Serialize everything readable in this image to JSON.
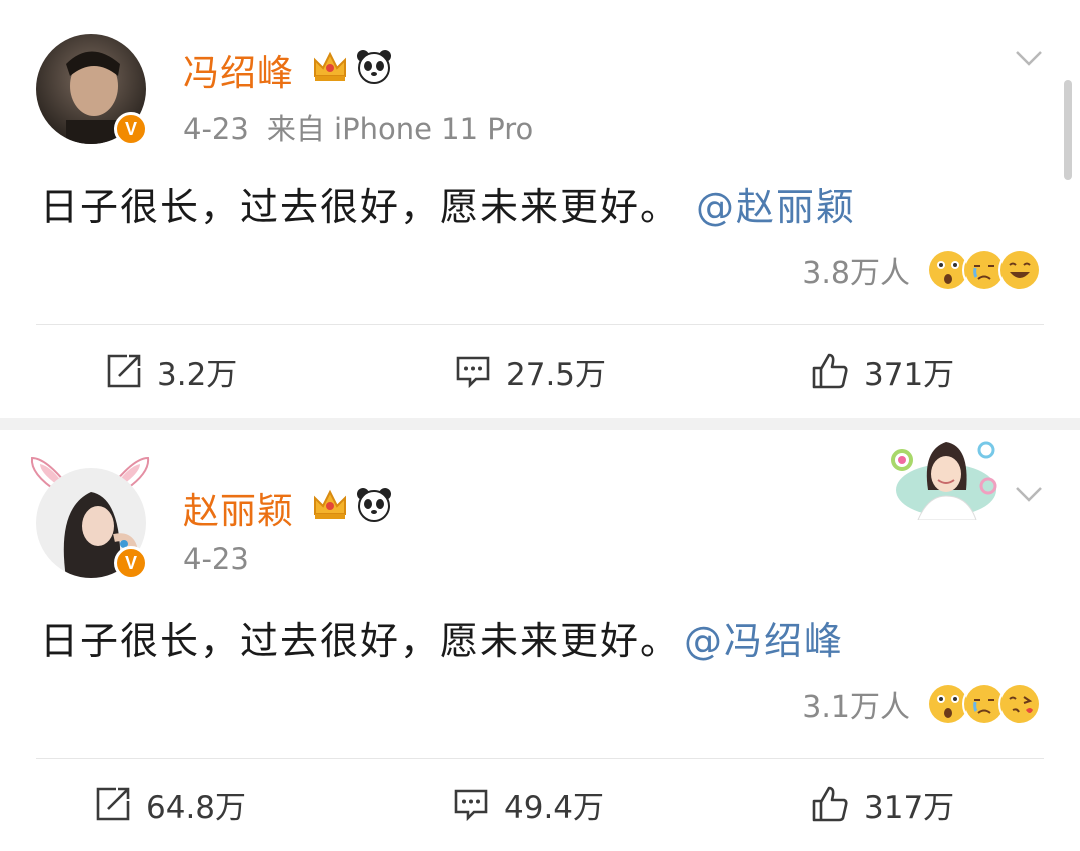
{
  "posts": [
    {
      "username": "冯绍峰",
      "date": "4-23",
      "source": "来自 iPhone 11 Pro",
      "text": "日子很长，过去很好，愿未来更好。",
      "mention": "@赵丽颖",
      "reaction_count": "3.8万人",
      "reaction_emojis": [
        "surprised-emoji",
        "crying-emoji",
        "laughing-emoji"
      ],
      "repost_count": "3.2万",
      "comment_count": "27.5万",
      "like_count": "371万"
    },
    {
      "username": "赵丽颖",
      "date": "4-23",
      "source": "",
      "text": "日子很长，过去很好，愿未来更好。",
      "mention": "@冯绍峰",
      "reaction_count": "3.1万人",
      "reaction_emojis": [
        "surprised-emoji",
        "crying-emoji",
        "kiss-emoji"
      ],
      "repost_count": "64.8万",
      "comment_count": "49.4万",
      "like_count": "317万"
    }
  ],
  "colors": {
    "username": "#eb7013",
    "mention": "#4e7cb0",
    "meta": "#8a8a8a",
    "verified_badge": "#f28a00"
  },
  "icons": [
    "crown-icon",
    "panda-icon",
    "chevron-down-icon",
    "repost-icon",
    "comment-icon",
    "like-icon",
    "verified-icon",
    "bunny-ears-icon"
  ]
}
